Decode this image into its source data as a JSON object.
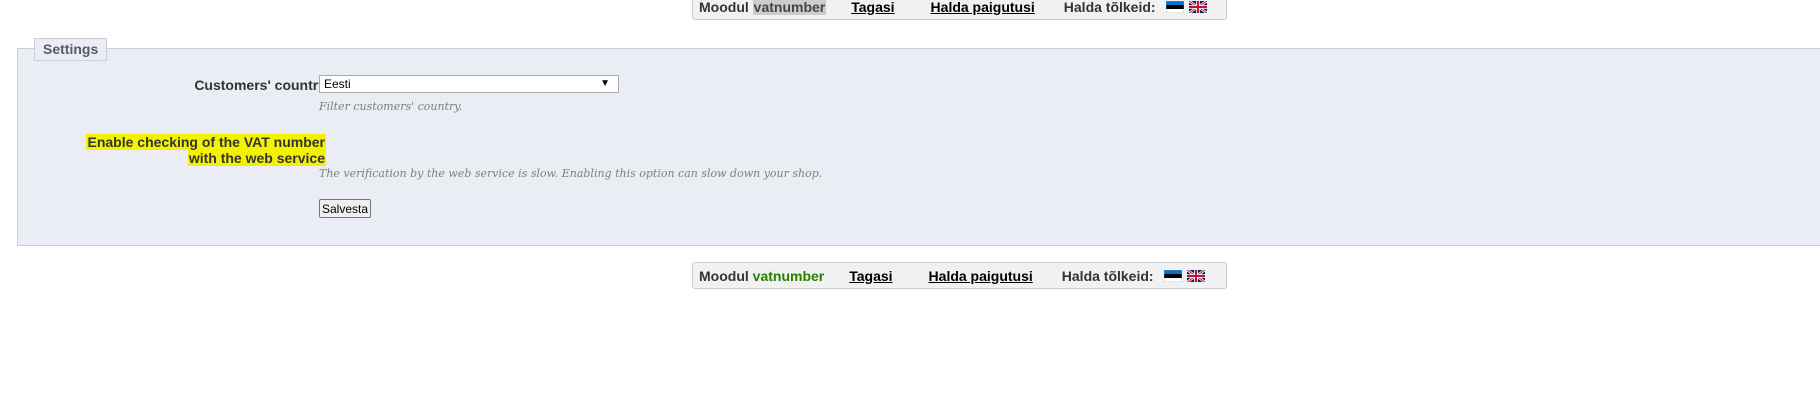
{
  "module_bar_top": {
    "module_label": "Moodul",
    "module_name": "vatnumber",
    "back_link": "Tagasi",
    "positions_link": "Halda paigutusi",
    "translations_label": "Halda tõlkeid:",
    "flags": [
      "estonia-flag-icon",
      "uk-flag-icon"
    ]
  },
  "module_bar_bottom": {
    "module_label": "Moodul",
    "module_name": "vatnumber",
    "back_link": "Tagasi",
    "positions_link": "Halda paigutusi",
    "translations_label": "Halda tõlkeid:",
    "flags": [
      "estonia-flag-icon",
      "uk-flag-icon"
    ]
  },
  "settings": {
    "legend": "Settings",
    "country_label": "Customers' country",
    "country_value": "Eesti",
    "country_hint": "Filter customers' country.",
    "vat_label_line1": "Enable checking of the VAT number",
    "vat_label_line2": "with the web service",
    "vat_hint": "The verification by the web service is slow. Enabling this option can slow down your shop.",
    "save_label": "Salvesta"
  },
  "colors": {
    "panel_bg": "#ebedf4",
    "highlight": "#f3f300",
    "module_name_green": "#268000"
  }
}
